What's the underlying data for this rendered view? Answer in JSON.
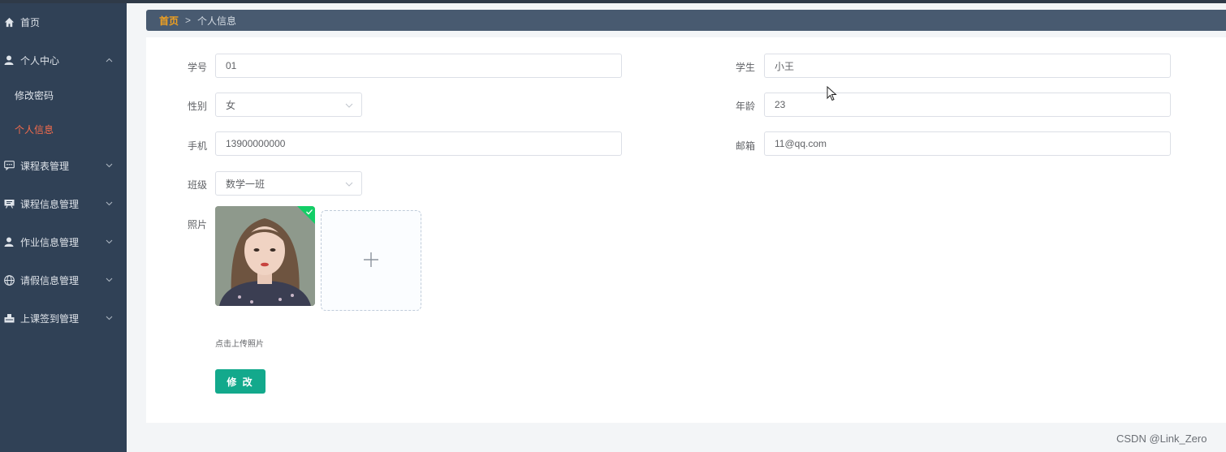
{
  "sidebar": {
    "items": [
      {
        "label": "首页",
        "icon": "home-icon"
      },
      {
        "label": "个人中心",
        "icon": "user-icon",
        "expanded": true,
        "children": [
          {
            "label": "修改密码"
          },
          {
            "label": "个人信息",
            "active": true
          }
        ]
      },
      {
        "label": "课程表管理",
        "icon": "chat-icon"
      },
      {
        "label": "课程信息管理",
        "icon": "board-icon"
      },
      {
        "label": "作业信息管理",
        "icon": "user-icon"
      },
      {
        "label": "请假信息管理",
        "icon": "globe-icon"
      },
      {
        "label": "上课签到管理",
        "icon": "stamp-icon"
      }
    ]
  },
  "breadcrumb": {
    "home": "首页",
    "separator": ">",
    "current": "个人信息"
  },
  "form": {
    "student_id": {
      "label": "学号",
      "value": "01"
    },
    "student_name": {
      "label": "学生",
      "value": "小王"
    },
    "gender": {
      "label": "性别",
      "value": "女"
    },
    "age": {
      "label": "年龄",
      "value": "23"
    },
    "phone": {
      "label": "手机",
      "value": "13900000000"
    },
    "email": {
      "label": "邮箱",
      "value": "11@qq.com"
    },
    "class": {
      "label": "班级",
      "value": "数学一班"
    },
    "photo": {
      "label": "照片",
      "hint": "点击上传照片"
    },
    "submit_label": "修 改"
  },
  "watermark": "CSDN @Link_Zero",
  "colors": {
    "sidebar_bg": "#304156",
    "active_menu": "#f56c4c",
    "breadcrumb_bg": "#485a70",
    "breadcrumb_home": "#f0a020",
    "primary_button": "#13a98c",
    "upload_success": "#13ce66"
  }
}
